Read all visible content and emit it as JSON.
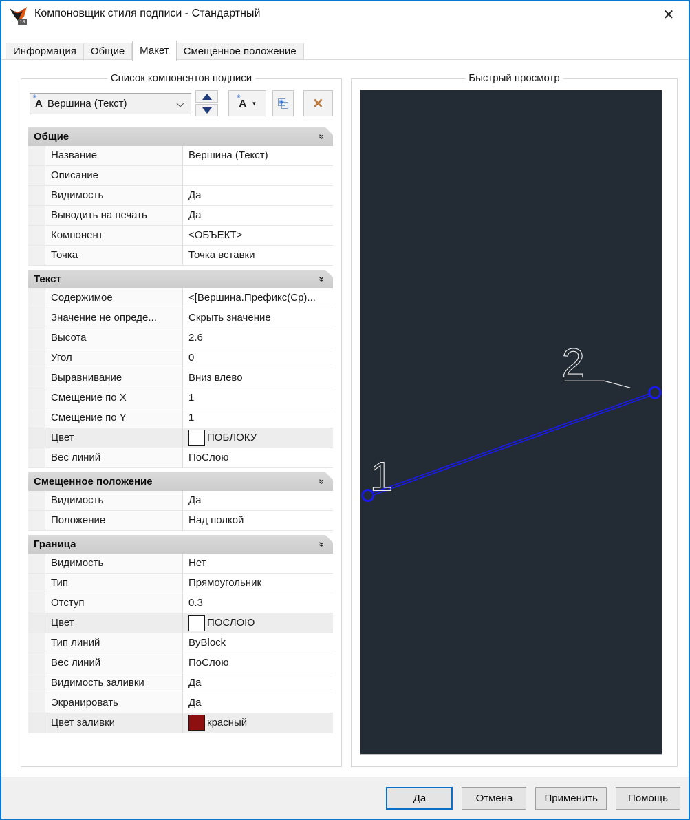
{
  "window": {
    "title": "Компоновщик стиля подписи - Стандартный",
    "logo_badge": "18",
    "close_glyph": "✕"
  },
  "tabs": [
    {
      "name": "tab-information",
      "label": "Информация",
      "active": false
    },
    {
      "name": "tab-general",
      "label": "Общие",
      "active": false
    },
    {
      "name": "tab-layout",
      "label": "Макет",
      "active": true
    },
    {
      "name": "tab-dragged-state",
      "label": "Смещенное положение",
      "active": false
    }
  ],
  "component_panel": {
    "group_title": "Список компонентов подписи",
    "selected_component": "Вершина (Текст)"
  },
  "icons": {
    "combo_component_letter": "A",
    "component_sparkle": "✳",
    "collapse_chevron": "»",
    "dropdown_arrow": "▾",
    "delete_x": "✕",
    "move_up": "triangle-up",
    "move_down": "triangle-down",
    "copy_component": "overlapping-squares-sparkle"
  },
  "properties": {
    "sections": [
      {
        "title": "Общие",
        "rows": [
          {
            "label": "Название",
            "value": "Вершина (Текст)"
          },
          {
            "label": "Описание",
            "value": ""
          },
          {
            "label": "Видимость",
            "value": "Да"
          },
          {
            "label": "Выводить на печать",
            "value": "Да"
          },
          {
            "label": "Компонент",
            "value": "<ОБЪЕКТ>"
          },
          {
            "label": "Точка",
            "value": "Точка вставки"
          }
        ]
      },
      {
        "title": "Текст",
        "rows": [
          {
            "label": "Содержимое",
            "value": "<[Вершина.Префикс(Ср)..."
          },
          {
            "label": "Значение не опреде...",
            "value": "Скрыть значение"
          },
          {
            "label": "Высота",
            "value": "2.6"
          },
          {
            "label": "Угол",
            "value": "0"
          },
          {
            "label": "Выравнивание",
            "value": "Вниз влево"
          },
          {
            "label": "Смещение по X",
            "value": "1"
          },
          {
            "label": "Смещение по Y",
            "value": "1"
          },
          {
            "label": "Цвет",
            "value": "ПОБЛОКУ",
            "swatch": "#ffffff"
          },
          {
            "label": "Вес линий",
            "value": "ПоСлою"
          }
        ]
      },
      {
        "title": "Смещенное положение",
        "rows": [
          {
            "label": "Видимость",
            "value": "Да"
          },
          {
            "label": "Положение",
            "value": "Над полкой"
          }
        ]
      },
      {
        "title": "Граница",
        "rows": [
          {
            "label": "Видимость",
            "value": "Нет"
          },
          {
            "label": "Тип",
            "value": "Прямоугольник"
          },
          {
            "label": "Отступ",
            "value": "0.3"
          },
          {
            "label": "Цвет",
            "value": "ПОСЛОЮ",
            "swatch": "#ffffff"
          },
          {
            "label": "Тип линий",
            "value": "ByBlock"
          },
          {
            "label": "Вес линий",
            "value": "ПоСлою"
          },
          {
            "label": "Видимость заливки",
            "value": "Да"
          },
          {
            "label": "Экранировать",
            "value": "Да"
          },
          {
            "label": "Цвет заливки",
            "value": "красный",
            "swatch": "#8e0f0f"
          }
        ]
      }
    ]
  },
  "preview": {
    "group_title": "Быстрый просмотр",
    "background_color": "#232b35",
    "line_color": "#1a1aee",
    "draw_color": "#ededed",
    "vertex1_label": "1",
    "vertex2_label": "2"
  },
  "footer": {
    "buttons": [
      {
        "name": "yes-button",
        "label": "Да",
        "default": true
      },
      {
        "name": "cancel-button",
        "label": "Отмена",
        "default": false
      },
      {
        "name": "apply-button",
        "label": "Применить",
        "default": false
      },
      {
        "name": "help-button",
        "label": "Помощь",
        "default": false
      }
    ]
  }
}
